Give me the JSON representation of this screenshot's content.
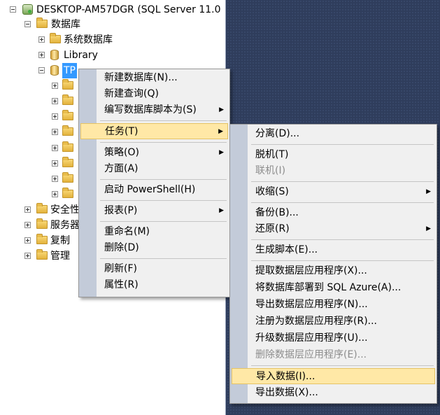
{
  "explorer": {
    "server_label": "DESKTOP-AM57DGR (SQL Server 11.0",
    "databases_label": "数据库",
    "system_db_label": "系统数据库",
    "library_label": "Library",
    "selected_db_label": "TP",
    "security_label": "安全性",
    "server_objects_label": "服务器",
    "replication_label": "复制",
    "management_label": "管理"
  },
  "context_menu": {
    "items": [
      {
        "label": "新建数据库(N)..."
      },
      {
        "label": "新建查询(Q)"
      },
      {
        "label": "编写数据库脚本为(S)"
      },
      {
        "label": "任务(T)"
      },
      {
        "label": "策略(O)"
      },
      {
        "label": "方面(A)"
      },
      {
        "label": "启动 PowerShell(H)"
      },
      {
        "label": "报表(P)"
      },
      {
        "label": "重命名(M)"
      },
      {
        "label": "删除(D)"
      },
      {
        "label": "刷新(F)"
      },
      {
        "label": "属性(R)"
      }
    ]
  },
  "tasks_submenu": {
    "items": [
      {
        "label": "分离(D)..."
      },
      {
        "label": "脱机(T)"
      },
      {
        "label": "联机(I)"
      },
      {
        "label": "收缩(S)"
      },
      {
        "label": "备份(B)..."
      },
      {
        "label": "还原(R)"
      },
      {
        "label": "生成脚本(E)..."
      },
      {
        "label": "提取数据层应用程序(X)..."
      },
      {
        "label": "将数据库部署到 SQL Azure(A)..."
      },
      {
        "label": "导出数据层应用程序(N)..."
      },
      {
        "label": "注册为数据层应用程序(R)..."
      },
      {
        "label": "升级数据层应用程序(U)..."
      },
      {
        "label": "删除数据层应用程序(E)..."
      },
      {
        "label": "导入数据(I)..."
      },
      {
        "label": "导出数据(X)..."
      }
    ]
  },
  "colors": {
    "highlight": "#ffe8a6",
    "selection": "#3399ff",
    "menu_gutter": "#c3cbd9"
  }
}
